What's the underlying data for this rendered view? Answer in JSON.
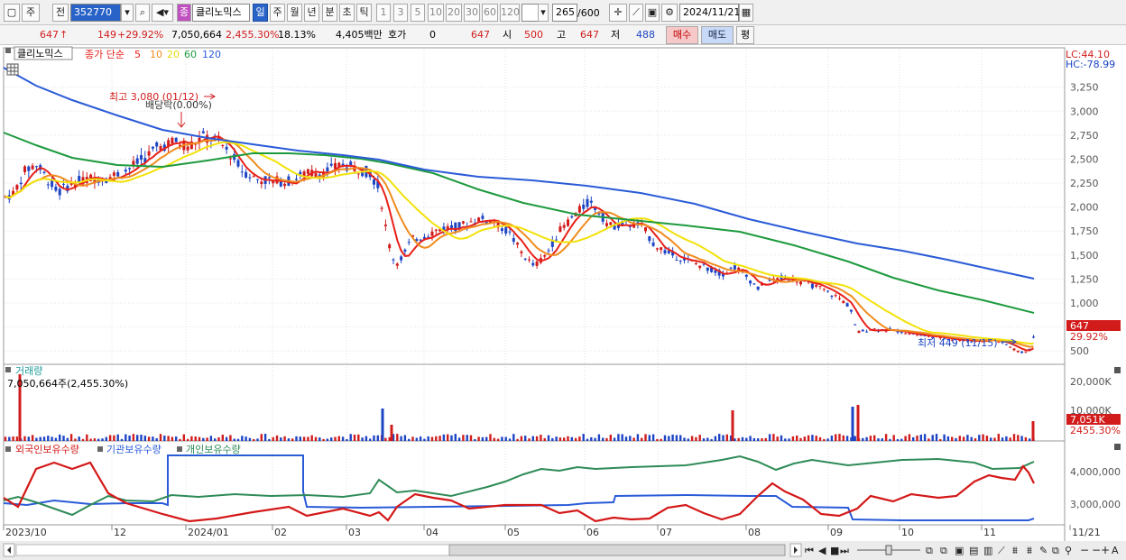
{
  "toolbar": {
    "market_tab": "주",
    "prev_tab": "전",
    "code": "352770",
    "name_badge": "종",
    "name": "클리노믹스",
    "periods": [
      "일",
      "주",
      "월",
      "년",
      "분",
      "초",
      "틱"
    ],
    "intervals": [
      "1",
      "3",
      "5",
      "10",
      "20",
      "30",
      "60",
      "120"
    ],
    "count": "265",
    "count_max": "/600",
    "date": "2024/11/21"
  },
  "quote": {
    "price": "647",
    "arrow": "↑",
    "change": "149",
    "change_pct": "+29.92%",
    "volume": "7,050,664",
    "volume_pct": "2,455.30%",
    "turnover": "18.13%",
    "amount": "4,405백만",
    "hoga_label": "호가",
    "hoga_value": "0",
    "hoga_price": "647",
    "open_label": "시",
    "open": "500",
    "high_label": "고",
    "high": "647",
    "low_label": "저",
    "low": "488",
    "buy_btn": "매수",
    "sell_btn": "매도",
    "avg_btn": "평"
  },
  "legend": {
    "name": "클리노믹스",
    "series": "종가 단순",
    "ma": [
      "5",
      "10",
      "20",
      "60",
      "120"
    ]
  },
  "lc_hc": {
    "lc": "LC:44.10",
    "hc": "HC:-78.99"
  },
  "annotations": {
    "high": "최고 3,080 (01/12)",
    "dividend": "배당락(0.00%)",
    "low": "최저 449 (11/15)"
  },
  "price_axis": [
    "3,250",
    "3,000",
    "2,750",
    "2,500",
    "2,250",
    "2,000",
    "1,750",
    "1,500",
    "1,250",
    "1,000",
    "750",
    "500"
  ],
  "price_tag": "647",
  "price_tag_pct": "29.92%",
  "volume_panel": {
    "title": "거래량",
    "info": "7,050,664주(2,455.30%)",
    "axis": [
      "20,000K",
      "10,000K"
    ],
    "tag": "7,051K",
    "tag_pct": "2455.30%"
  },
  "holding_panel": {
    "labels": [
      "외국인보유수량",
      "기관보유수량",
      "개인보유수량"
    ],
    "axis": [
      "4,000,000",
      "3,000,000"
    ]
  },
  "x_axis": [
    "2023/10",
    "12",
    "2024/01",
    "02",
    "03",
    "04",
    "05",
    "06",
    "07",
    "08",
    "09",
    "10",
    "11",
    "11/21"
  ],
  "colors": {
    "ma5": "#e8201a",
    "ma10": "#f08c1e",
    "ma20": "#f2e20a",
    "ma60": "#1e9a3e",
    "ma120": "#2a5bd7",
    "foreign": "#d41818",
    "inst": "#2a5bd7",
    "retail": "#2e8b57",
    "up": "#d21c1c",
    "down": "#1d44c4"
  }
}
